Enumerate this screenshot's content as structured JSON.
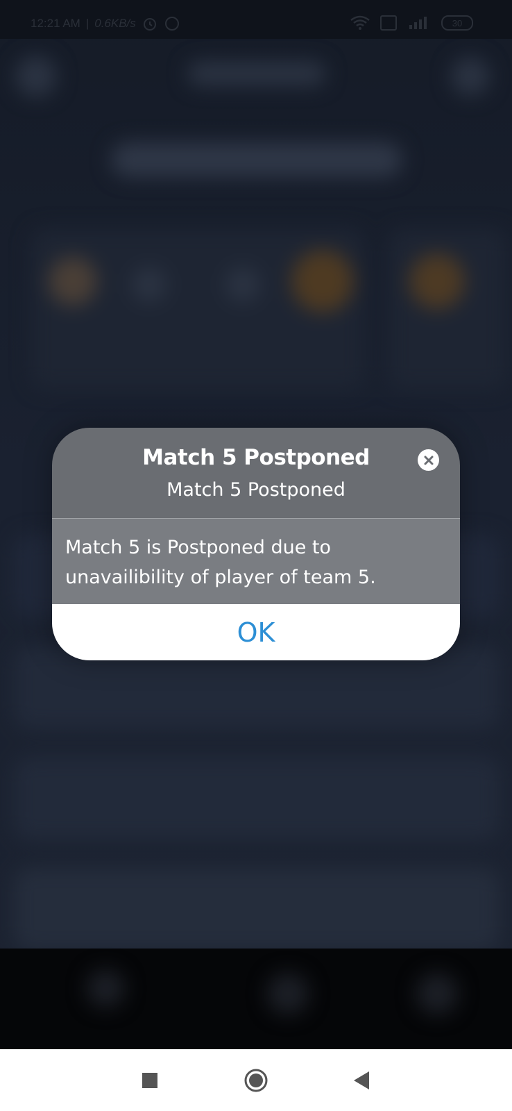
{
  "status_bar": {
    "time": "12:21 AM",
    "separator": "|",
    "speed": "0.6KB/s",
    "battery": "30"
  },
  "dialog": {
    "title": "Match 5 Postponed",
    "subtitle": "Match 5 Postponed",
    "message": "Match 5 is Postponed due to unavailibility of player of team 5.",
    "ok_label": "OK",
    "close_icon": "close-circle-icon"
  },
  "system_nav": {
    "recents_icon": "square-icon",
    "home_icon": "circle-icon",
    "back_icon": "triangle-back-icon"
  },
  "colors": {
    "accent": "#2d8fd5",
    "dialog_header": "#6a6d72",
    "dialog_body": "#7a7d82",
    "background": "#1a2130"
  }
}
